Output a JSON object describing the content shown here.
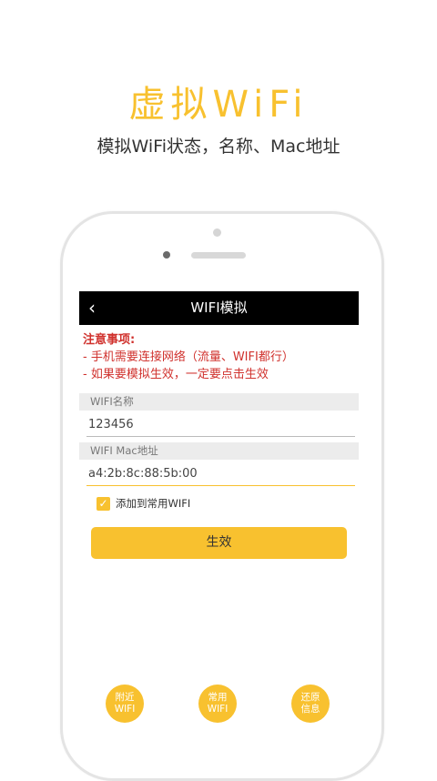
{
  "promo": {
    "title": "虚拟WiFi",
    "subtitle": "模拟WiFi状态，名称、Mac地址"
  },
  "app_bar": {
    "back_icon": "chevron-left-icon",
    "back_glyph": "‹",
    "title": "WIFI模拟"
  },
  "notice": {
    "title": "注意事项:",
    "line1": "- 手机需要连接网络（流量、WIFI都行）",
    "line2": "- 如果要模拟生效，一定要点击生效"
  },
  "wifi_name": {
    "label": "WIFI名称",
    "value": "123456"
  },
  "wifi_mac": {
    "label": "WIFI Mac地址",
    "value": "a4:2b:8c:88:5b:00"
  },
  "favorite_checkbox": {
    "checked": true,
    "glyph": "✓",
    "label": "添加到常用WIFI"
  },
  "apply_button": {
    "label": "生效"
  },
  "bottom_actions": [
    {
      "line1": "附近",
      "line2": "WIFI"
    },
    {
      "line1": "常用",
      "line2": "WIFI"
    },
    {
      "line1": "还原",
      "line2": "信息"
    }
  ],
  "colors": {
    "accent": "#f8c12f",
    "notice": "#d0312d",
    "app_bar": "#000000"
  }
}
